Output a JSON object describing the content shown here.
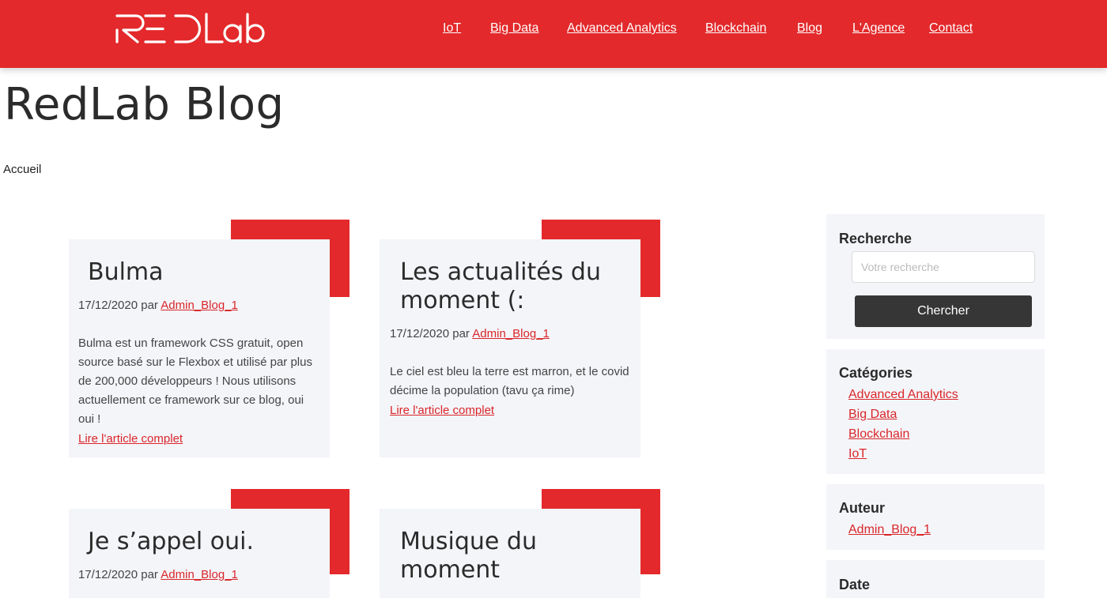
{
  "header": {
    "logo_alt": "RED Lab",
    "brand_color": "#e3292b",
    "nav": [
      "IoT",
      "Big Data",
      "Advanced Analytics",
      "Blockchain",
      "Blog",
      "L'Agence",
      "Contact"
    ]
  },
  "page": {
    "title": "RedLab Blog",
    "breadcrumb": "Accueil"
  },
  "posts": [
    {
      "title": "Bulma",
      "date": "17/12/2020",
      "by": "par",
      "author": "Admin_Blog_1",
      "excerpt": "Bulma est un framework CSS gratuit, open source basé sur le Flexbox et utilisé par plus de 200,000 développeurs ! Nous utilisons actuellement ce framework sur ce blog, oui oui !",
      "read_more": "Lire l'article complet"
    },
    {
      "title": "Les actualités du moment (:",
      "date": "17/12/2020",
      "by": "par",
      "author": "Admin_Blog_1",
      "excerpt": "Le ciel est bleu la terre est marron, et le covid décime la population (tavu ça rime)",
      "read_more": "Lire l'article complet"
    },
    {
      "title": "Je s’appel oui.",
      "date": "17/12/2020",
      "by": "par",
      "author": "Admin_Blog_1"
    },
    {
      "title": "Musique du moment"
    }
  ],
  "sidebar": {
    "search": {
      "title": "Recherche",
      "placeholder": "Votre recherche",
      "button": "Chercher"
    },
    "categories": {
      "title": "Catégories",
      "items": [
        "Advanced Analytics",
        "Big Data",
        "Blockchain",
        "IoT"
      ]
    },
    "author": {
      "title": "Auteur",
      "items": [
        "Admin_Blog_1"
      ]
    },
    "date": {
      "title": "Date"
    }
  }
}
